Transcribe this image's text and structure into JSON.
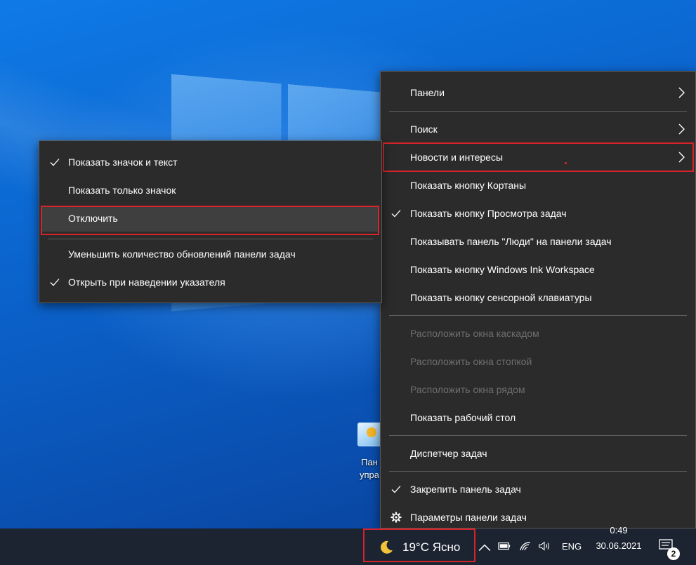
{
  "main_menu": {
    "items": [
      {
        "label": "Панели",
        "submenu": true
      },
      {
        "label": "Поиск",
        "submenu": true
      },
      {
        "label": "Новости и интересы",
        "submenu": true
      },
      {
        "label": "Показать кнопку Кортаны"
      },
      {
        "label": "Показать кнопку Просмотра задач",
        "checked": true
      },
      {
        "label": "Показывать панель \"Люди\" на панели задач"
      },
      {
        "label": "Показать кнопку Windows Ink Workspace"
      },
      {
        "label": "Показать кнопку сенсорной клавиатуры"
      },
      {
        "label": "Расположить окна каскадом",
        "disabled": true
      },
      {
        "label": "Расположить окна стопкой",
        "disabled": true
      },
      {
        "label": "Расположить окна рядом",
        "disabled": true
      },
      {
        "label": "Показать рабочий стол"
      },
      {
        "label": "Диспетчер задач"
      },
      {
        "label": "Закрепить панель задач",
        "checked": true
      },
      {
        "label": "Параметры панели задач",
        "icon": "gear-icon"
      }
    ]
  },
  "sub_menu": {
    "items": [
      {
        "label": "Показать значок и текст",
        "checked": true
      },
      {
        "label": "Показать только значок"
      },
      {
        "label": "Отключить"
      },
      {
        "label": "Уменьшить количество обновлений панели задач"
      },
      {
        "label": "Открыть при наведении указателя",
        "checked": true
      }
    ]
  },
  "desktop_icon": {
    "label": "Пан упра",
    "icon": "control-panel-icon"
  },
  "taskbar": {
    "weather": {
      "text": "19°C  Ясно",
      "icon": "moon-icon"
    },
    "language": "ENG",
    "clock": {
      "time": "0:49",
      "date": "30.06.2021"
    },
    "notifications": "2"
  },
  "colors": {
    "menu_bg": "#2b2b2b",
    "highlight_border": "#d8232a",
    "taskbar_bg": "#1b2430"
  }
}
